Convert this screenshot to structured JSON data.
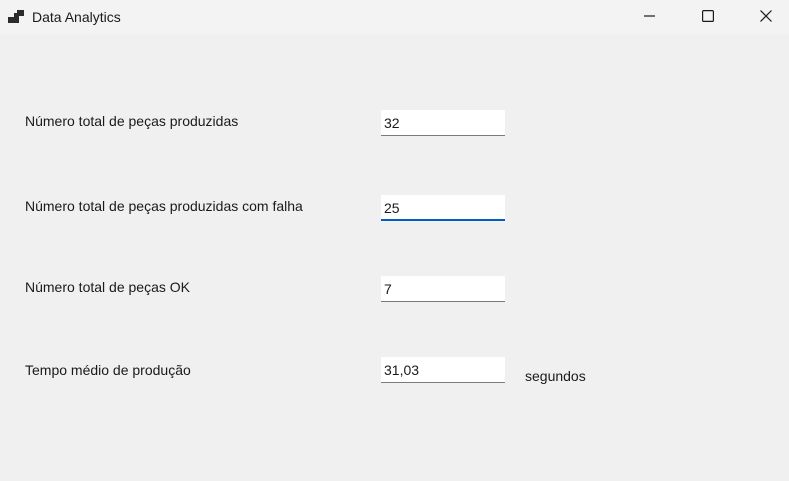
{
  "window": {
    "title": "Data Analytics",
    "icon": "app-window-icon"
  },
  "controls": {
    "minimize_icon": "minimize-icon",
    "maximize_icon": "maximize-icon",
    "close_icon": "close-icon"
  },
  "form": {
    "fields": [
      {
        "label": "Número total de peças produzidas",
        "value": "32"
      },
      {
        "label": "Número total de peças produzidas com falha",
        "value": "25"
      },
      {
        "label": "Número total de peças OK",
        "value": "7"
      },
      {
        "label": "Tempo médio de produção",
        "value": "31,03",
        "unit": "segundos"
      }
    ]
  },
  "colors": {
    "background": "#f0f0f0",
    "focus_accent": "#005fb8"
  }
}
